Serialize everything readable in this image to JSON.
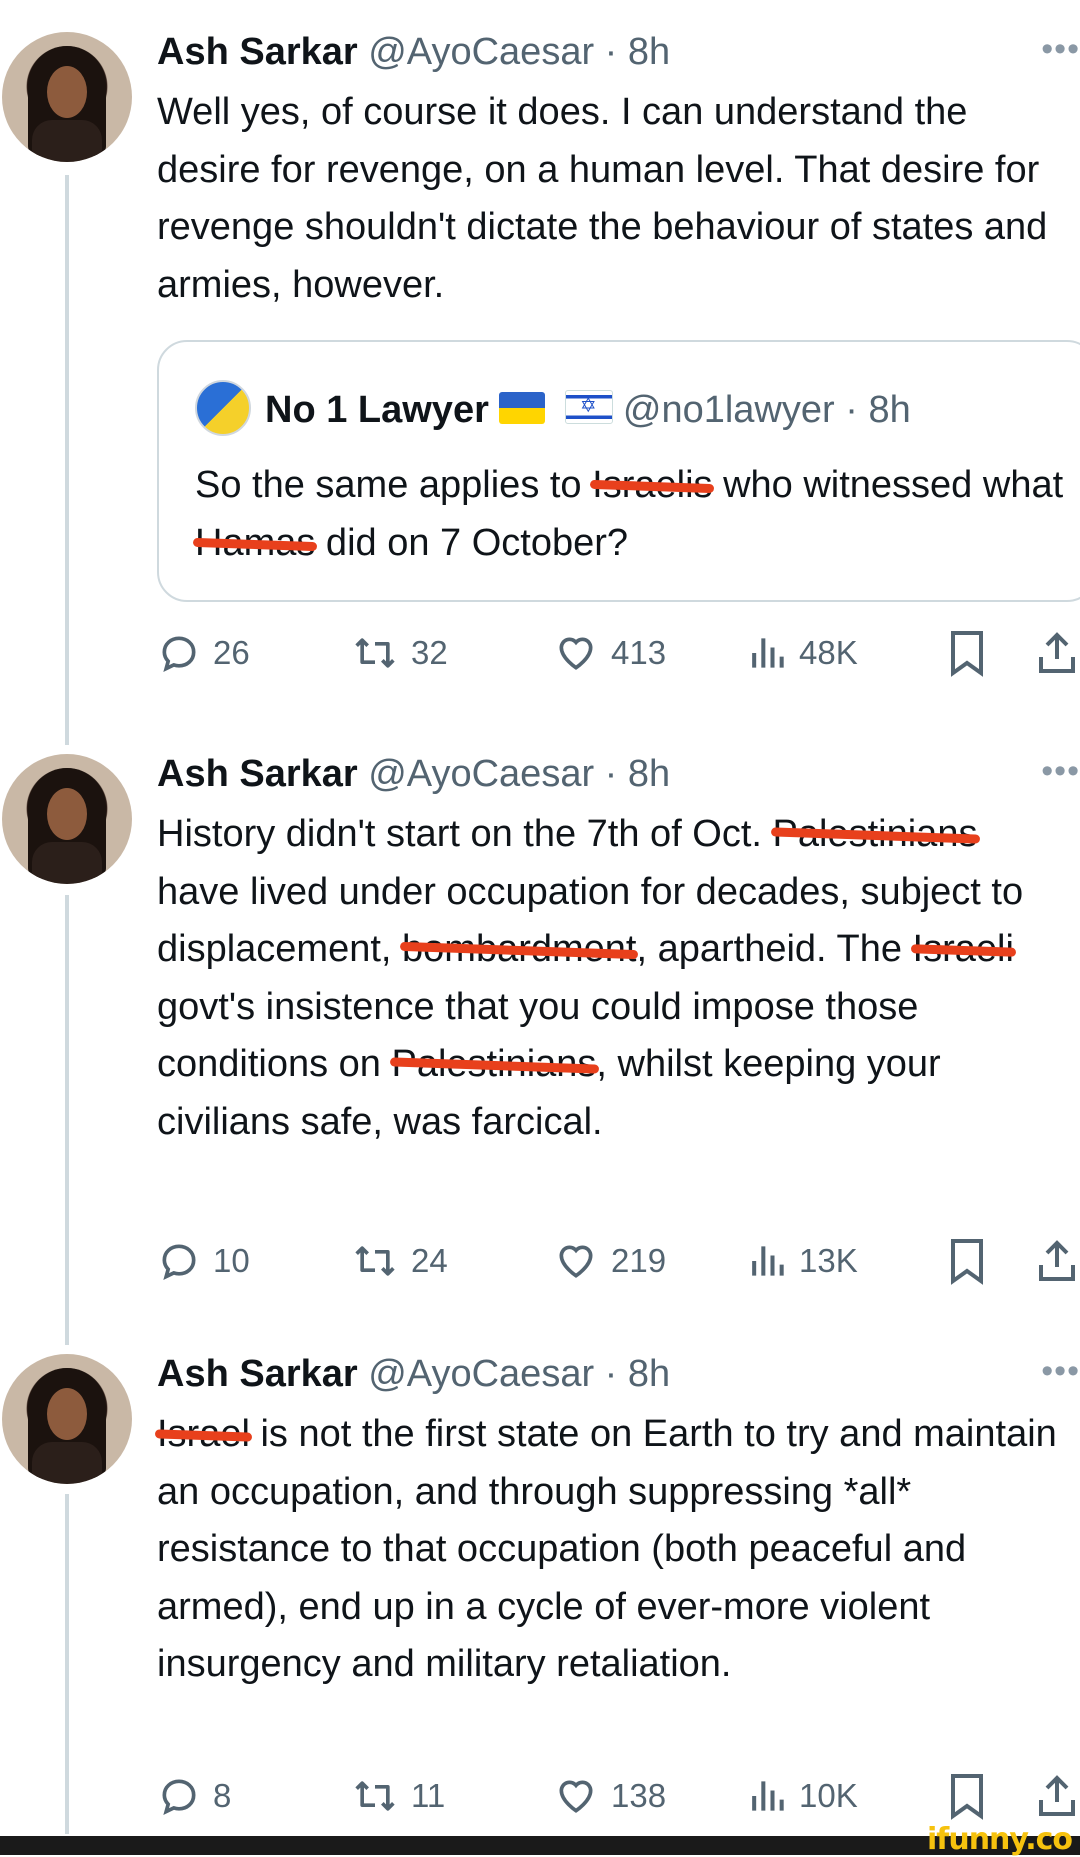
{
  "tweets": [
    {
      "author": "Ash Sarkar",
      "handle": "@AyoCaesar",
      "time": "8h",
      "more": "•••",
      "text_parts": [
        "Well yes, of course it does. I can understand the desire for revenge, on a human level. That desire for revenge shouldn't dictate the behaviour of states and armies, however."
      ],
      "quote": {
        "author": "No 1 Lawyer",
        "handle": "@no1lawyer",
        "time": "8h",
        "flags": [
          "ukraine-flag",
          "israel-flag"
        ],
        "text": {
          "a": "So the same applies to ",
          "r1": "Israelis",
          "b": " who witnessed what ",
          "r2": "Hamas",
          "c": " did on 7 October?"
        }
      },
      "replies": "26",
      "retweets": "32",
      "likes": "413",
      "views": "48K"
    },
    {
      "author": "Ash Sarkar",
      "handle": "@AyoCaesar",
      "time": "8h",
      "more": "•••",
      "text": {
        "a": "History didn't start on the 7th of Oct. ",
        "r1": "Palestinians",
        "b": " have lived under occupation for decades, subject to displacement, ",
        "r2": "bombardment",
        "c": ", apartheid. The ",
        "r3": "Israeli",
        "d": " govt's insistence that you could impose those conditions on ",
        "r4": "Palestinians",
        "e": ", whilst keeping your civilians safe, was farcical."
      },
      "replies": "10",
      "retweets": "24",
      "likes": "219",
      "views": "13K"
    },
    {
      "author": "Ash Sarkar",
      "handle": "@AyoCaesar",
      "time": "8h",
      "more": "•••",
      "text": {
        "r1": "Israel",
        "a": " is not the first state on Earth to try and maintain an occupation, and through suppressing *all* resistance to that occupation (both peaceful and armed), end up in a cycle of ever-more violent insurgency and military retaliation."
      },
      "replies": "8",
      "retweets": "11",
      "likes": "138",
      "views": "10K"
    }
  ],
  "watermark": "ifunny.co",
  "colors": {
    "text": "#0f1419",
    "secondary": "#536471",
    "thread_line": "#cfd9de",
    "redaction": "#e8401c"
  },
  "icons": [
    "reply-icon",
    "retweet-icon",
    "like-icon",
    "views-icon",
    "bookmark-icon",
    "share-icon",
    "more-icon"
  ]
}
